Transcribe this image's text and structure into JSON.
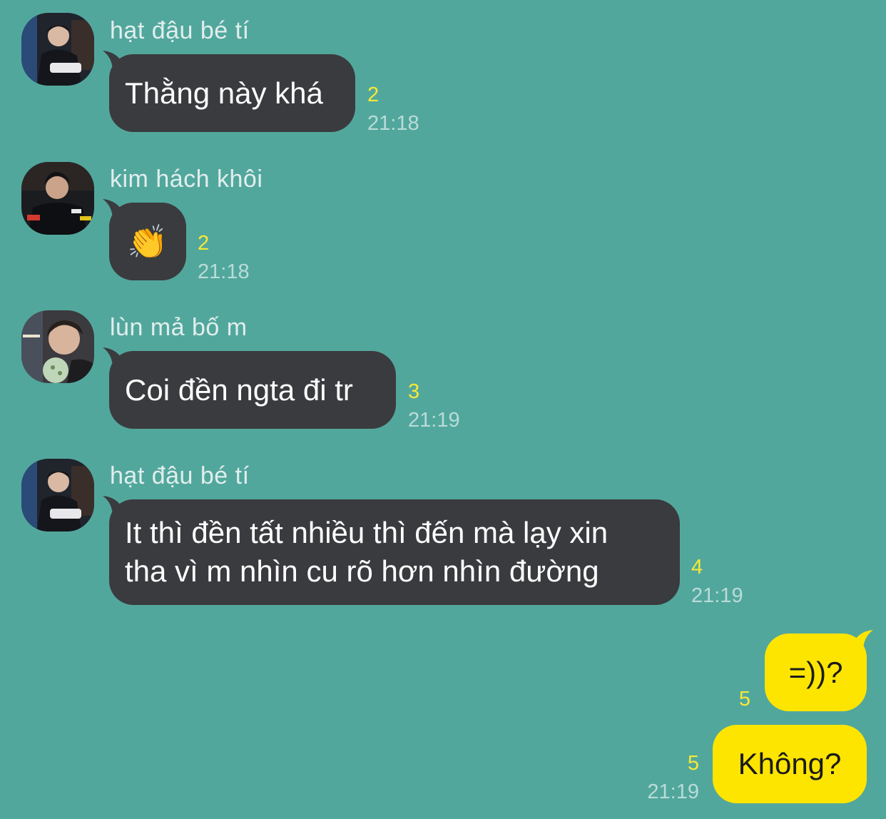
{
  "messages": [
    {
      "sender": "hạt đậu bé tí",
      "avatar_icon": "profile-photo-icon",
      "text": "Thằng này khá",
      "unread": "2",
      "time": "21:18"
    },
    {
      "sender": "kim hách khôi",
      "avatar_icon": "profile-photo-icon",
      "text": "👏",
      "unread": "2",
      "time": "21:18"
    },
    {
      "sender": "lùn mả bố m",
      "avatar_icon": "profile-photo-icon",
      "text": "Coi đền ngta đi tr",
      "unread": "3",
      "time": "21:19"
    },
    {
      "sender": "hạt đậu bé tí",
      "avatar_icon": "profile-photo-icon",
      "text_lines": [
        "It thì đền tất nhiều thì đến mà lạy xin",
        "tha vì m nhìn cu rõ hơn nhìn đường"
      ],
      "unread": "4",
      "time": "21:19"
    }
  ],
  "my_messages": [
    {
      "text": "=))?",
      "unread": "5"
    },
    {
      "text": "Không?",
      "unread": "5",
      "time": "21:19"
    }
  ],
  "colors": {
    "background": "#52a79d",
    "incoming_bubble": "#3a3b3e",
    "outgoing_bubble": "#fee500",
    "unread_count": "#f6e935"
  }
}
